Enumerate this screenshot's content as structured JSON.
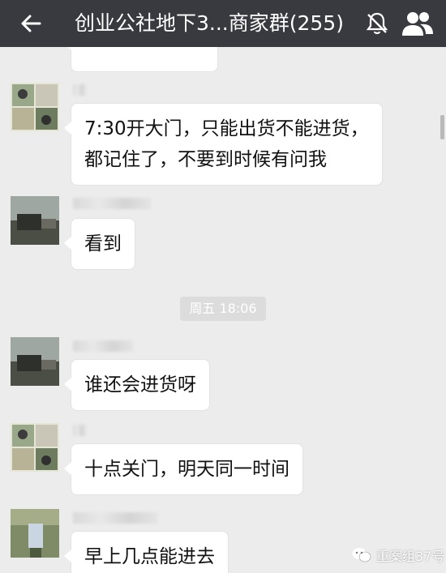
{
  "header": {
    "title": "创业公社地下3...商家群(255)",
    "back_icon": "back-arrow-icon",
    "mute_icon": "muted-bell-icon",
    "group_icon": "group-members-icon"
  },
  "messages": [
    {
      "text": "7:30开大门，只能出货不能进货，\n都记住了，不要到时候有问我"
    },
    {
      "text": "看到"
    },
    {
      "text": "谁还会进货呀"
    },
    {
      "text": "十点关门，明天同一时间"
    },
    {
      "text": "早上几点能进去"
    }
  ],
  "timestamp": "周五 18:06",
  "watermark": "重案组37号",
  "colors": {
    "header_bg": "#393a3f",
    "chat_bg": "#ececec",
    "bubble_bg": "#ffffff"
  }
}
